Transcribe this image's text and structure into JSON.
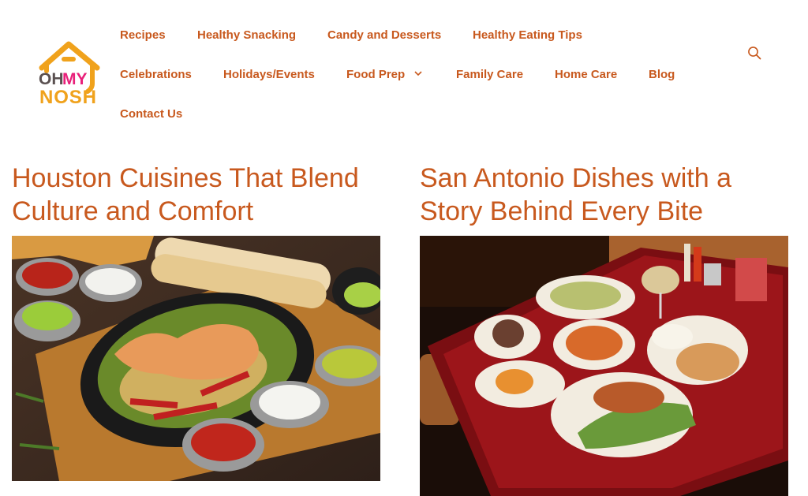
{
  "site": {
    "logo_text_oh": "OH",
    "logo_text_my": "MY",
    "logo_text_nosh": "NOSH",
    "brand_orange": "#f0a21c",
    "brand_grey": "#5a5050",
    "brand_magenta": "#e8207a"
  },
  "nav": {
    "items": [
      {
        "label": "Recipes"
      },
      {
        "label": "Healthy Snacking"
      },
      {
        "label": "Candy and Desserts"
      },
      {
        "label": "Healthy Eating Tips"
      },
      {
        "label": "Celebrations"
      },
      {
        "label": "Holidays/Events"
      },
      {
        "label": "Food Prep"
      },
      {
        "label": "Family Care"
      },
      {
        "label": "Home Care"
      },
      {
        "label": "Blog"
      },
      {
        "label": "Contact Us"
      }
    ],
    "link_color": "#c8591e",
    "search_icon": "search-icon",
    "dropdown_icon": "chevron-down-icon"
  },
  "posts": [
    {
      "title": "Houston Cuisines That Blend Culture and Comfort",
      "image": "fajitas-with-shrimp-image"
    },
    {
      "title": "San Antonio Dishes with a Story Behind Every Bite",
      "image": "mexican-dinner-table-image"
    }
  ]
}
